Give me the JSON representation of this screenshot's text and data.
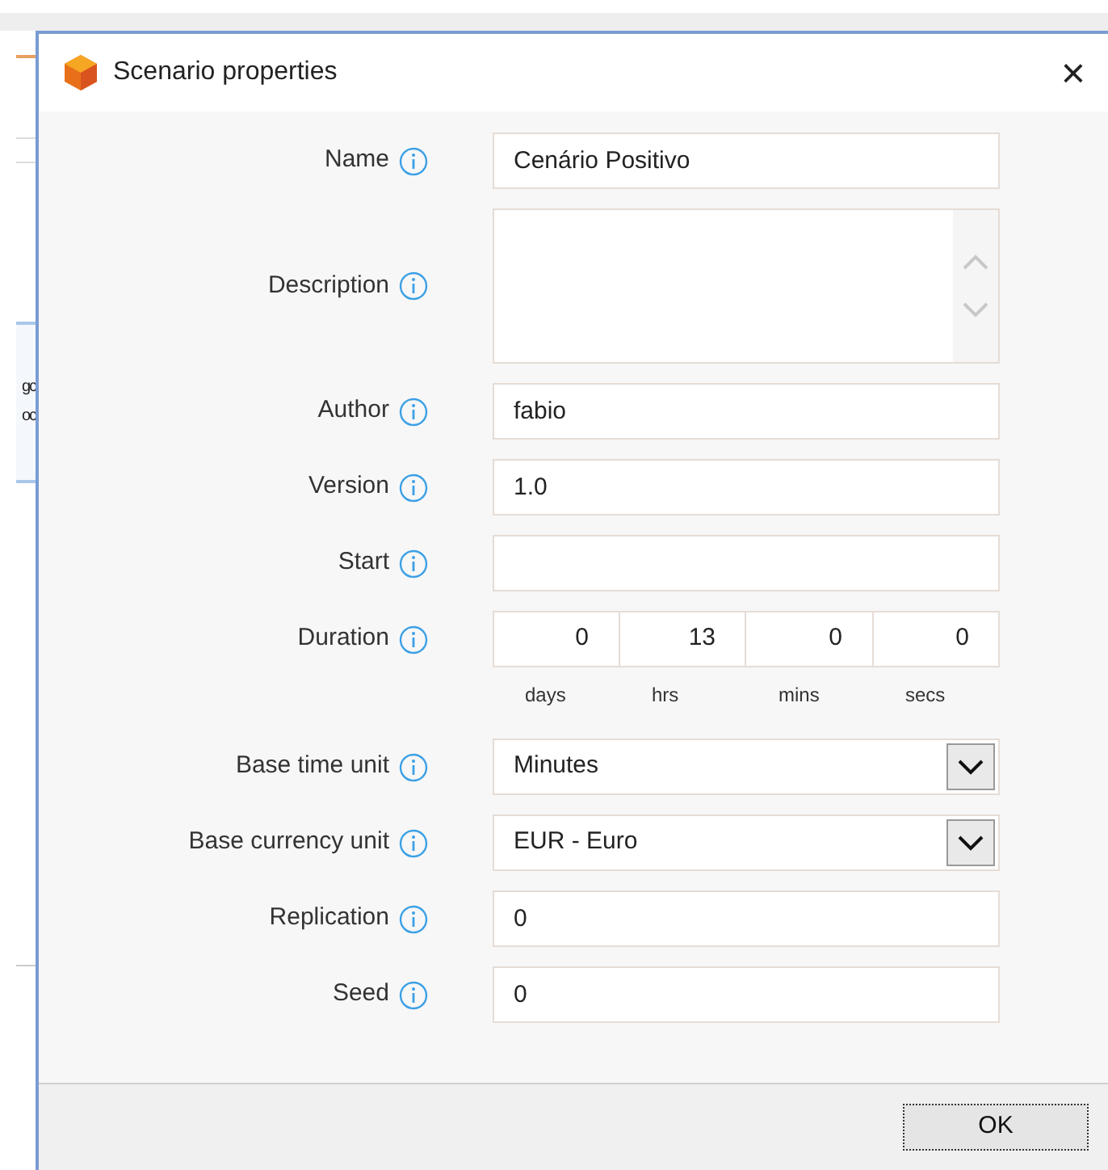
{
  "background_window": {
    "texts": [
      "gc",
      "oc"
    ]
  },
  "dialog": {
    "title": "Scenario properties",
    "close_label": "×",
    "fields": [
      {
        "kind": "text",
        "label": "Name",
        "value": "Cenário Positivo"
      },
      {
        "kind": "textarea",
        "label": "Description"
      },
      {
        "kind": "text",
        "label": "Author",
        "value": "fabio"
      },
      {
        "kind": "text",
        "label": "Version",
        "value": "1.0"
      },
      {
        "kind": "text",
        "label": "Start"
      },
      {
        "kind": "duration",
        "label": "Duration",
        "parts": [
          {
            "value": "0",
            "unit": "days"
          },
          {
            "value": "13",
            "unit": "hrs"
          },
          {
            "value": "0",
            "unit": "mins"
          },
          {
            "value": "0",
            "unit": "secs"
          }
        ]
      },
      {
        "kind": "select",
        "label": "Base time unit",
        "value": "Minutes"
      },
      {
        "kind": "select",
        "label": "Base currency unit",
        "value": "EUR - Euro"
      },
      {
        "kind": "text",
        "label": "Replication",
        "value": "0"
      },
      {
        "kind": "text",
        "label": "Seed",
        "value": "0"
      }
    ],
    "buttons": [
      "OK"
    ]
  }
}
